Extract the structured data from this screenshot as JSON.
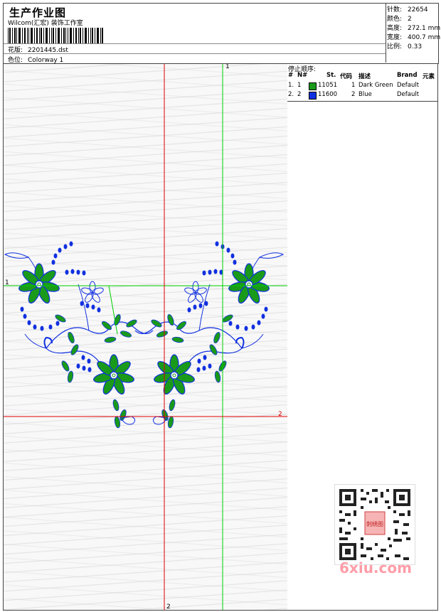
{
  "header": {
    "title": "生产作业图",
    "subtitle": "Wilcom(汇宏) 装饰工作室",
    "design_label": "花版:",
    "design_value": "2201445.dst",
    "colorway_label": "色位:",
    "colorway_value": "Colorway 1"
  },
  "stats": {
    "stitches_label": "针数:",
    "stitches_value": "22654",
    "colors_label": "颜色:",
    "colors_value": "2",
    "height_label": "高度:",
    "height_value": "272.1 mm",
    "width_label": "宽度:",
    "width_value": "400.7 mm",
    "scale_label": "比例:",
    "scale_value": "0.33"
  },
  "stops": {
    "title": "停止顺序:",
    "headers": {
      "num": "#",
      "n": "N#",
      "st": "St.",
      "code": "代码",
      "desc": "描述",
      "brand": "Brand",
      "elem": "元素"
    },
    "rows": [
      {
        "num": "1.",
        "n": "1",
        "st": "11051",
        "code": "1",
        "desc": "Dark Green",
        "brand": "Default",
        "color": "#1a9a1a"
      },
      {
        "num": "2.",
        "n": "2",
        "st": "11600",
        "code": "2",
        "desc": "Blue",
        "brand": "Default",
        "color": "#1030e0"
      }
    ]
  },
  "canvas": {
    "marker_top": "1",
    "marker_left": "1",
    "marker_right": "2",
    "marker_bottom": "2",
    "guide_red": "#e00000",
    "guide_green": "#00d000"
  },
  "watermark": {
    "text": "6xiu.com",
    "qr_center": "刺绣图"
  }
}
